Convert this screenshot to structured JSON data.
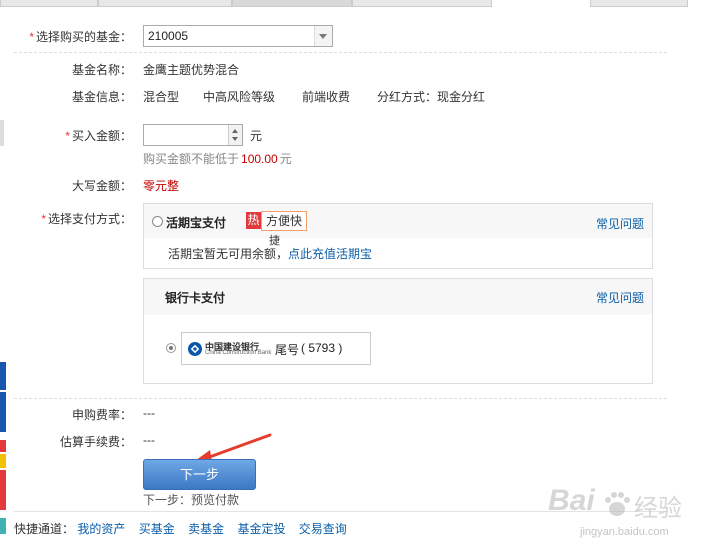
{
  "fund_select": {
    "label": "选择购买的基金：",
    "value": "210005"
  },
  "fund_name": {
    "label": "基金名称：",
    "value": "金鹰主题优势混合"
  },
  "fund_info": {
    "label": "基金信息：",
    "type": "混合型",
    "risk": "中高风险等级",
    "fee": "前端收费",
    "dividend": "分红方式：现金分红"
  },
  "amount": {
    "label": "买入金额：",
    "value": "",
    "unit": "元",
    "hint_prefix": "购买金额不能低于",
    "hint_value": "100.00",
    "hint_unit": "元"
  },
  "capital": {
    "label": "大写金额：",
    "value": "零元整"
  },
  "payment": {
    "label": "选择支付方式：",
    "huoqibao": {
      "title": "活期宝支付",
      "hot": "热",
      "tag": "方便快",
      "tag_overflow": "捷",
      "faq": "常见问题",
      "notice": "活期宝暂无可用余额，",
      "recharge": "点此充值活期宝"
    },
    "bank": {
      "title": "银行卡支付",
      "faq": "常见问题",
      "bank_name_cn": "中国建设银行",
      "bank_name_en": "China Construction Bank",
      "tail_label": "尾号",
      "tail_value": "( 5793 )"
    }
  },
  "purchase_rate": {
    "label": "申购费率：",
    "value": "---"
  },
  "est_fee": {
    "label": "估算手续费：",
    "value": "---"
  },
  "next_button": {
    "label": "下一步"
  },
  "next_hint": "下一步：预览付款",
  "quick_links": {
    "label": "快捷通道：",
    "items": [
      "我的资产",
      "买基金",
      "卖基金",
      "基金定投",
      "交易查询"
    ]
  },
  "watermark": {
    "brand": "Bai",
    "brand2": "经验",
    "url": "jingyan.baidu.com"
  },
  "colors": {
    "link": "#0a5ea8",
    "required": "#e4393c",
    "capital": "#c40000",
    "button": "#3b78c4",
    "hot": "#e4393c"
  }
}
